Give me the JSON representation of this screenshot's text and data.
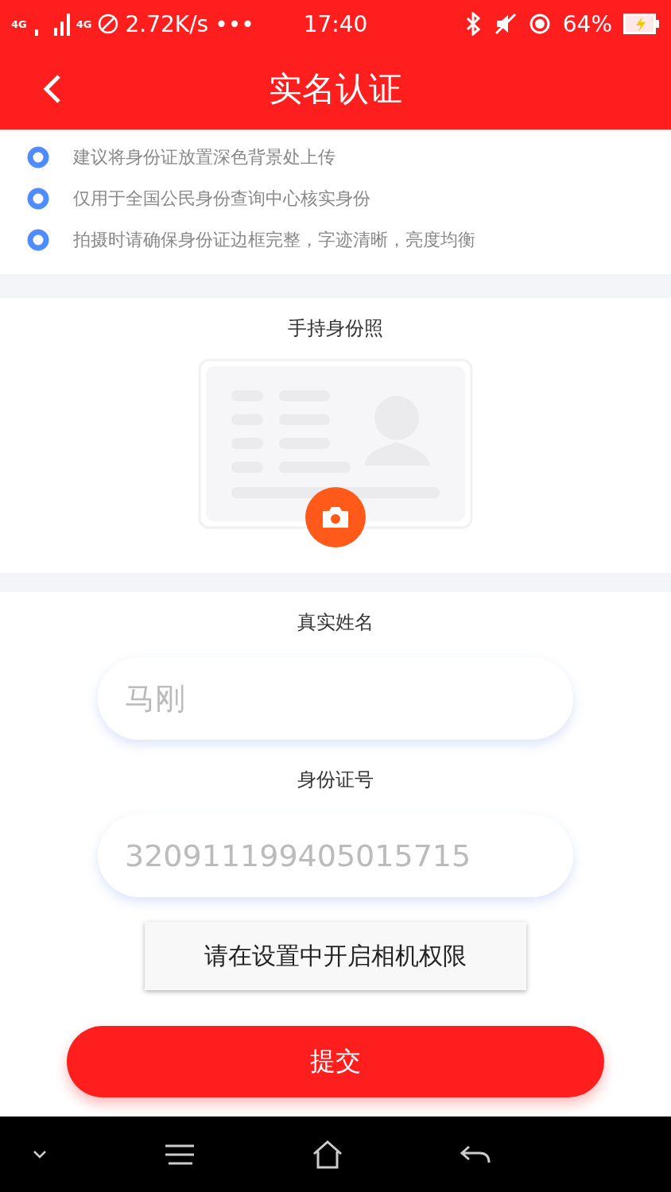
{
  "status_bar": {
    "network_labels": [
      "4G",
      "4G"
    ],
    "speed": "2.72K/s",
    "more": "•••",
    "time": "17:40",
    "battery": "64%"
  },
  "header": {
    "title": "实名认证"
  },
  "tips": [
    "建议将身份证放置深色背景处上传",
    "仅用于全国公民身份查询中心核实身份",
    "拍摄时请确保身份证边框完整，字迹清晰，亮度均衡"
  ],
  "photo": {
    "label": "手持身份照"
  },
  "fields": [
    {
      "label": "真实姓名",
      "value": "马刚"
    },
    {
      "label": "身份证号",
      "value": "320911199405015715"
    }
  ],
  "toast": "请在设置中开启相机权限",
  "submit": "提交"
}
